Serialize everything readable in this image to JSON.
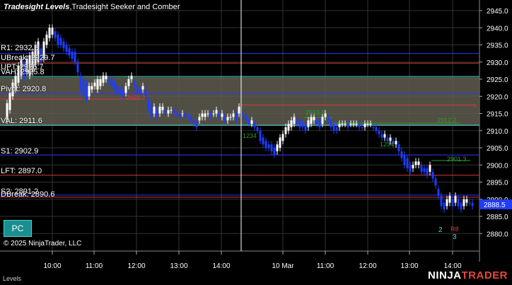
{
  "title_bold": "Tradesight Levels",
  "title_rest": ",Tradesight Seeker and Comber",
  "levels": {
    "r1": "R1: 2932.5",
    "ubreak": "UBreak: 2929.7",
    "upt": "UPT: 2926.7",
    "vah": "VAH: 2925.8",
    "pivot": "Pivot: 2920.8",
    "val": "VAL: 2911.6",
    "s1": "S1: 2902.9",
    "lft": "LFT: 2897.0",
    "s2": "S2: 2891.2",
    "dbreak": "DBreak: 2890.6"
  },
  "y_ticks": [
    "2945.0",
    "2940.0",
    "2935.0",
    "2930.0",
    "2925.0",
    "2920.0",
    "2915.0",
    "2910.0",
    "2905.0",
    "2900.0",
    "2895.0",
    "2890.0",
    "2885.0",
    "2880.0"
  ],
  "x_ticks": [
    "10:00",
    "11:00",
    "12:00",
    "13:00",
    "14:00",
    "10 Mar",
    "11:00",
    "12:00",
    "13:00",
    "14:00"
  ],
  "last_price": "2888.5",
  "annotations": {
    "mid_green": "2913.8",
    "right_green": "2912.2",
    "s_green": "2901.3",
    "red_mark": "2919.2",
    "count_a": "1234",
    "count_b": "1234",
    "num_2": "2",
    "num_3": "3",
    "num_r8": "R8"
  },
  "pc_label": "PC",
  "copyright": "© 2025 NinjaTrader, LLC",
  "tab_label": "Levels",
  "brand": {
    "a": "NINJA",
    "b": "TRADER"
  },
  "colors": {
    "blue_level": "#2a3aff",
    "red_level": "#d63a3a",
    "cyan_level": "#3fd6d6",
    "value_area": "#5f5d4f",
    "candle": "#ffffff",
    "down_bar": "#1f3cff",
    "green_text": "#2f9a2f"
  }
}
